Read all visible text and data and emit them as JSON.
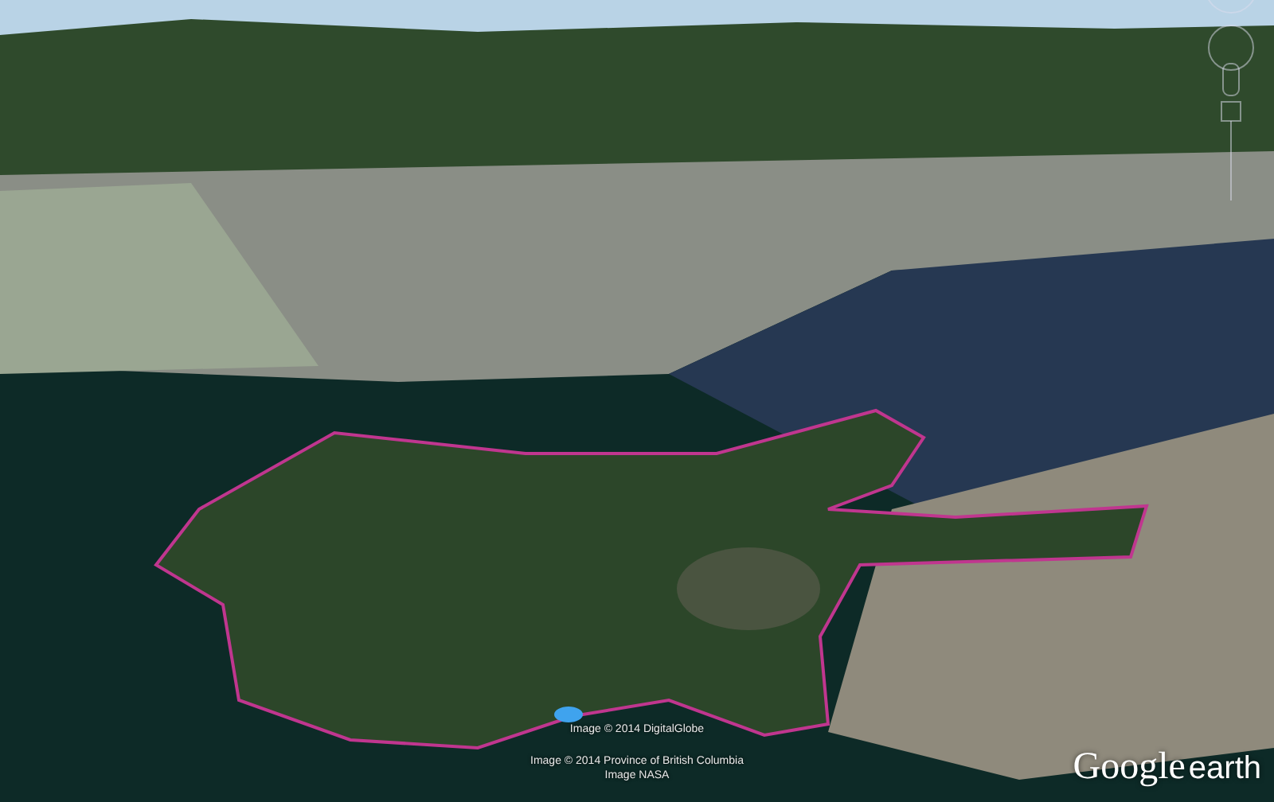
{
  "attributions": [
    "Image © 2014 DigitalGlobe",
    "Image © 2014 Province of British Columbia",
    "Image NASA"
  ],
  "logo": {
    "brand": "Google",
    "product": "earth"
  }
}
